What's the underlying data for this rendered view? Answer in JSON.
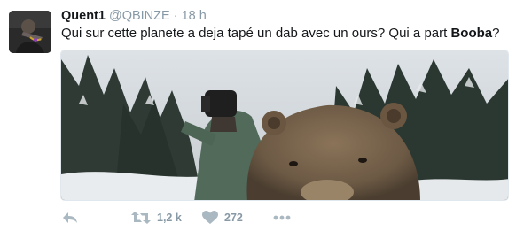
{
  "tweet": {
    "display_name": "Quent1",
    "handle": "@QBINZE",
    "separator": "·",
    "timestamp": "18 h",
    "text_before": "Qui sur cette planete a deja tapé un dab avec un ours? Qui a part ",
    "text_bold": "Booba",
    "text_after": "?"
  },
  "actions": {
    "reply_icon": "reply-arrow-icon",
    "retweet_icon": "retweet-icon",
    "retweet_count": "1,2 k",
    "like_icon": "heart-icon",
    "like_count": "272",
    "more_icon": "more-dots-icon"
  },
  "colors": {
    "text": "#14171a",
    "muted": "#8899a6",
    "icon": "#aab8c2"
  }
}
